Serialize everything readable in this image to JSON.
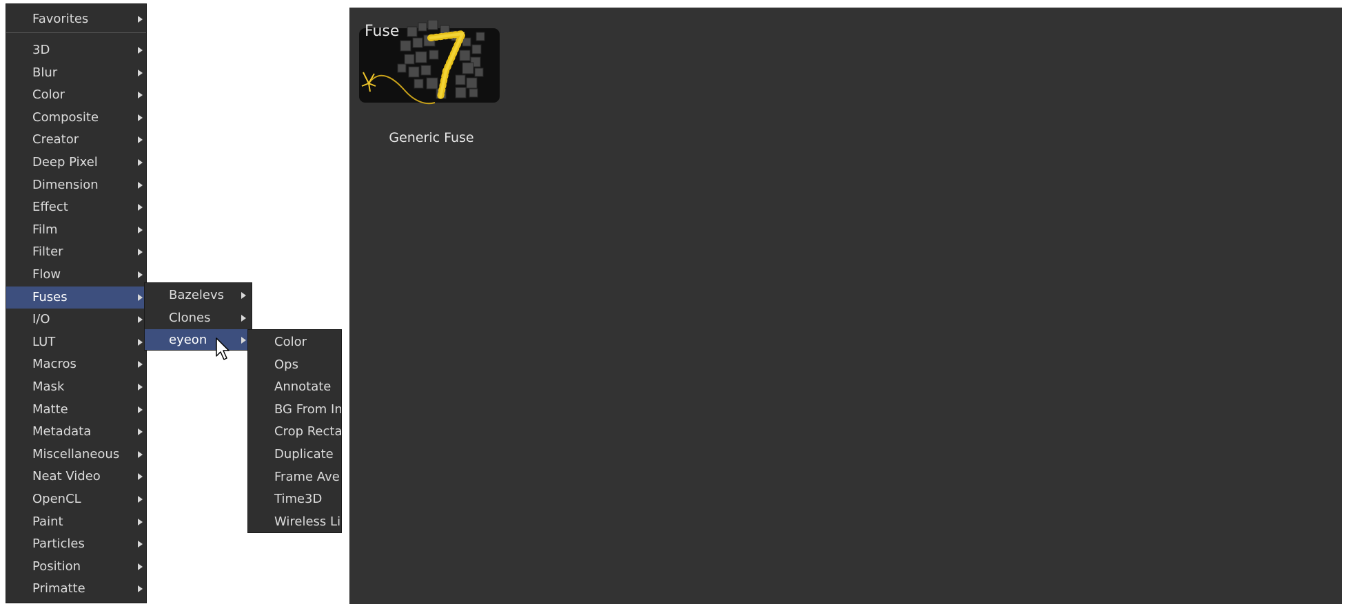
{
  "main_menu": {
    "favorites": "Favorites",
    "items": [
      "3D",
      "Blur",
      "Color",
      "Composite",
      "Creator",
      "Deep Pixel",
      "Dimension",
      "Effect",
      "Film",
      "Filter",
      "Flow",
      "Fuses",
      "I/O",
      "LUT",
      "Macros",
      "Mask",
      "Matte",
      "Metadata",
      "Miscellaneous",
      "Neat Video",
      "OpenCL",
      "Paint",
      "Particles",
      "Position",
      "Primatte"
    ],
    "highlighted": "Fuses"
  },
  "fuses_submenu": {
    "items": [
      "Bazelevs",
      "Clones",
      "eyeon"
    ],
    "highlighted": "eyeon"
  },
  "eyeon_submenu": {
    "items": [
      "Color",
      "Ops",
      "Annotate",
      "BG From In",
      "Crop Recta",
      "Duplicate",
      "Frame Ave",
      "Time3D",
      "Wireless Li"
    ]
  },
  "preview": {
    "badge": "Fuse",
    "caption": "Generic Fuse",
    "accent_color": "#e8c21a",
    "canvas_color": "#333333"
  },
  "colors": {
    "menu_bg": "#2f2f2f",
    "highlight": "#3d4f7e"
  }
}
